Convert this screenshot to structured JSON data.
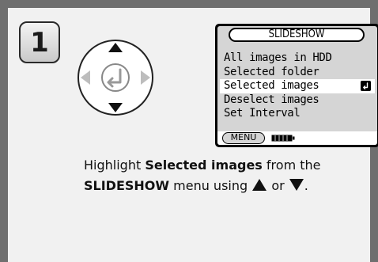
{
  "step": {
    "number": "1"
  },
  "lcd": {
    "title": "SLIDESHOW",
    "items": [
      {
        "label": "All images in HDD"
      },
      {
        "label": "Selected folder"
      },
      {
        "label": "Selected images",
        "selected": true
      },
      {
        "label": "Deselect images"
      },
      {
        "label": "Set Interval"
      }
    ],
    "menu_label": "MENU",
    "enter_icon": "enter-icon",
    "battery_icon": "battery-icon"
  },
  "dpad": {
    "icons": [
      "up-arrow-icon",
      "down-arrow-icon",
      "left-arrow-icon",
      "right-arrow-icon",
      "enter-icon"
    ]
  },
  "instruction": {
    "part1": "Highlight ",
    "bold1": "Selected images",
    "part2": " from the",
    "bold2": "SLIDESHOW",
    "part3": " menu using ",
    "part4": " or ",
    "part5": "."
  },
  "colors": {
    "frame": "#6f6f6f",
    "panel": "#f1f1f1",
    "lcd_bg": "#d5d5d5"
  }
}
